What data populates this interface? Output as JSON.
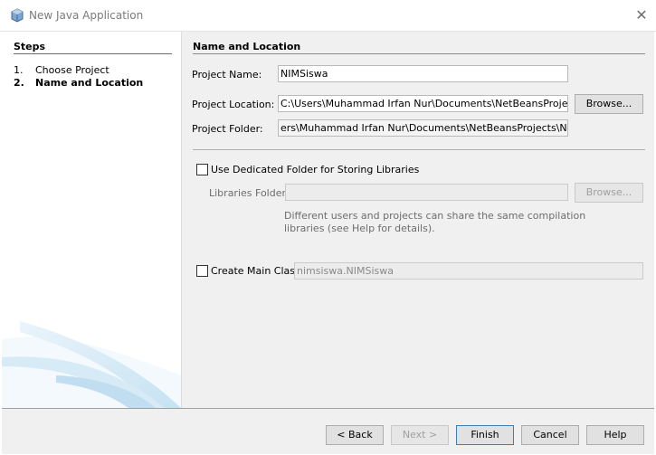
{
  "window": {
    "title": "New Java Application",
    "icon": "java-cup-icon"
  },
  "steps": {
    "heading": "Steps",
    "items": [
      {
        "num": "1.",
        "label": "Choose Project"
      },
      {
        "num": "2.",
        "label": "Name and Location"
      }
    ]
  },
  "form": {
    "section_title": "Name and Location",
    "project_name_label": "Project Name:",
    "project_name_value": "NIMSiswa",
    "project_location_label": "Project Location:",
    "project_location_value": "C:\\Users\\Muhammad Irfan Nur\\Documents\\NetBeansProjects",
    "project_folder_label": "Project Folder:",
    "project_folder_value": "ers\\Muhammad Irfan Nur\\Documents\\NetBeansProjects\\NIMSiswa",
    "browse_label": "Browse...",
    "dedicated_folder_label": "Use Dedicated Folder for Storing Libraries",
    "libraries_folder_label": "Libraries Folder:",
    "libraries_folder_value": "",
    "libraries_browse_label": "Browse...",
    "libraries_help_line1": "Different users and projects can share the same compilation",
    "libraries_help_line2": "libraries (see Help for details).",
    "create_main_class_label": "Create Main Class",
    "main_class_value": "nimsiswa.NIMSiswa"
  },
  "buttons": {
    "back": "< Back",
    "next": "Next >",
    "finish": "Finish",
    "cancel": "Cancel",
    "help": "Help"
  }
}
